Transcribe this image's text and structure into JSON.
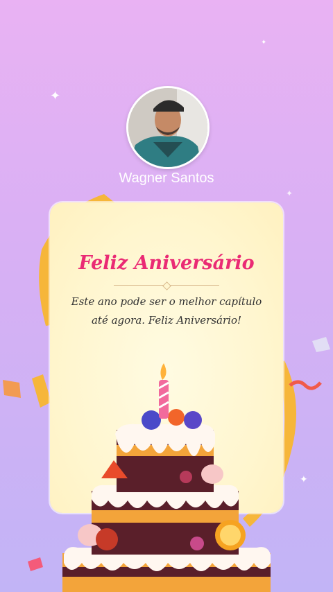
{
  "profile": {
    "name": "Wagner Santos",
    "avatar_icon": "user-photo"
  },
  "card": {
    "title": "Feliz Aniversário",
    "message": "Este ano pode ser o melhor capítulo até agora. Feliz Aniversário!"
  },
  "colors": {
    "title": "#ea2a74",
    "background_top": "#e9b2f3",
    "background_bottom": "#c2b4f6",
    "ribbon": "#f6b63a"
  },
  "decor": {
    "cake_icon": "birthday-cake-icon",
    "candle_icon": "candle-icon",
    "ribbon_icon": "ribbon-icon",
    "confetti_icon": "confetti-icon"
  }
}
